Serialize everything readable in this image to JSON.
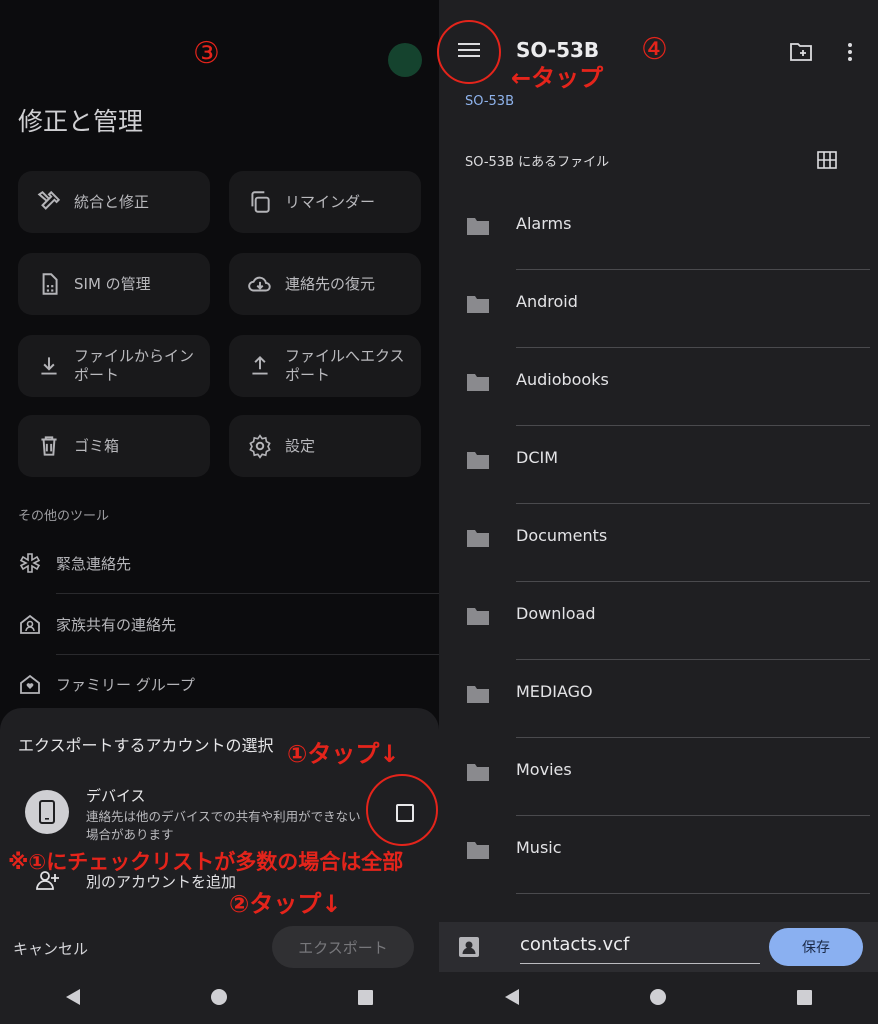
{
  "contacts_panel": {
    "title": "修正と管理",
    "tiles": [
      {
        "label": "統合と修正",
        "icon": "tools-icon"
      },
      {
        "label": "リマインダー",
        "icon": "copy-icon"
      },
      {
        "label": "SIM の管理",
        "icon": "sim-card-icon"
      },
      {
        "label": "連絡先の復元",
        "icon": "cloud-restore-icon"
      },
      {
        "label": "ファイルからインポート",
        "icon": "download-icon"
      },
      {
        "label": "ファイルへエクスポート",
        "icon": "upload-icon"
      },
      {
        "label": "ゴミ箱",
        "icon": "trash-icon"
      },
      {
        "label": "設定",
        "icon": "gear-icon"
      }
    ],
    "other_tools_label": "その他のツール",
    "tools": [
      {
        "label": "緊急連絡先",
        "icon": "emergency-icon"
      },
      {
        "label": "家族共有の連絡先",
        "icon": "family-contacts-icon"
      },
      {
        "label": "ファミリー グループ",
        "icon": "family-group-icon"
      }
    ]
  },
  "export_sheet": {
    "title": "エクスポートするアカウントの選択",
    "device_name": "デバイス",
    "device_desc": "連絡先は他のデバイスでの共有や利用ができない場合があります",
    "add_account": "別のアカウントを追加",
    "cancel": "キャンセル",
    "export": "エクスポート"
  },
  "file_picker": {
    "title": "SO-53B",
    "breadcrumb": "SO-53B",
    "files_label": "SO-53B にあるファイル",
    "folders": [
      "Alarms",
      "Android",
      "Audiobooks",
      "DCIM",
      "Documents",
      "Download",
      "MEDIAGO",
      "Movies",
      "Music"
    ],
    "filename": "contacts.vcf",
    "save": "保存"
  },
  "annotations": {
    "step3": "③",
    "step4": "④",
    "tap_menu": "←タップ",
    "tap1": "①タップ↓",
    "note": "※①にチェックリストが多数の場合は全部",
    "tap2": "②タップ↓"
  },
  "colors": {
    "annotation": "#e4241b",
    "accent_blue": "#8ab0f1",
    "panel_dark": "#0c0c0e",
    "panel_gray": "#1f1f22"
  }
}
